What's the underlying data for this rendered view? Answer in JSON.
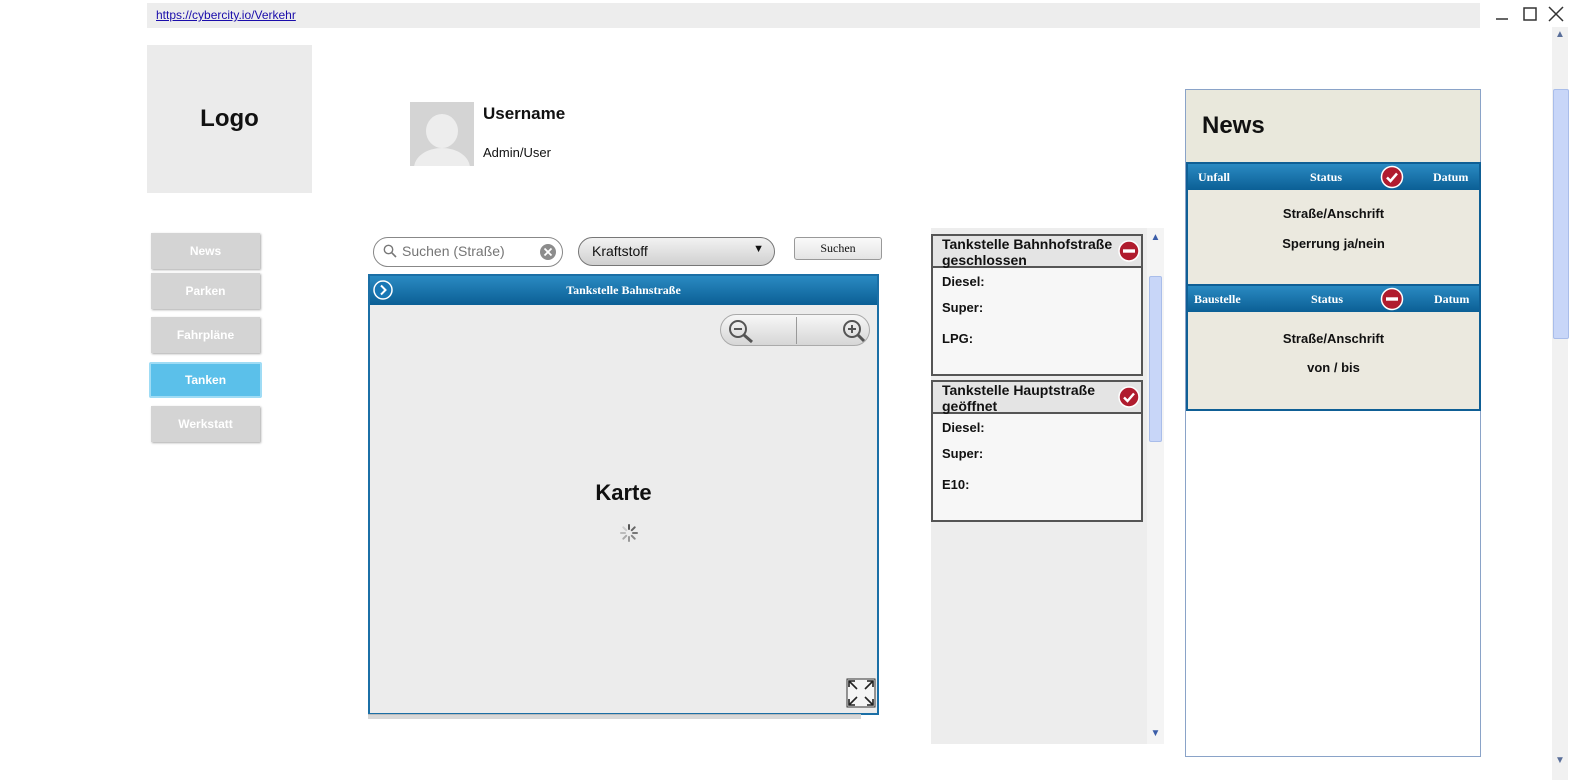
{
  "browser": {
    "url": "https://cybercity.io/Verkehr"
  },
  "logo": {
    "text": "Logo"
  },
  "user": {
    "name": "Username",
    "role": "Admin/User"
  },
  "nav": {
    "items": [
      "News",
      "Parken",
      "Fahrpläne",
      "Tanken",
      "Werkstatt"
    ],
    "active": "Tanken"
  },
  "search": {
    "placeholder": "Suchen (Straße)",
    "fuel_select": "Kraftstoff",
    "button": "Suchen"
  },
  "map": {
    "title": "Tankstelle Bahnstraße",
    "label": "Karte"
  },
  "stations": [
    {
      "title": "Tankstelle Bahnhofstraße geschlossen",
      "status": "closed",
      "fuels": [
        "Diesel:",
        "Super:",
        "LPG:"
      ]
    },
    {
      "title": "Tankstelle Hauptstraße geöffnet",
      "status": "open",
      "fuels": [
        "Diesel:",
        "Super:",
        "E10:"
      ]
    }
  ],
  "news": {
    "title": "News",
    "cards": [
      {
        "type": "Unfall",
        "status_label": "Status",
        "date_label": "Datum",
        "status": "ok",
        "lines": [
          "Straße/Anschrift",
          "Sperrung ja/nein"
        ]
      },
      {
        "type": "Baustelle",
        "status_label": "Status",
        "date_label": "Datum",
        "status": "blocked",
        "lines": [
          "Straße/Anschrift",
          "von / bis"
        ]
      }
    ]
  },
  "colors": {
    "accent": "#0b5f95",
    "active_nav": "#5bc0ea",
    "status_red": "#b01c2e"
  }
}
